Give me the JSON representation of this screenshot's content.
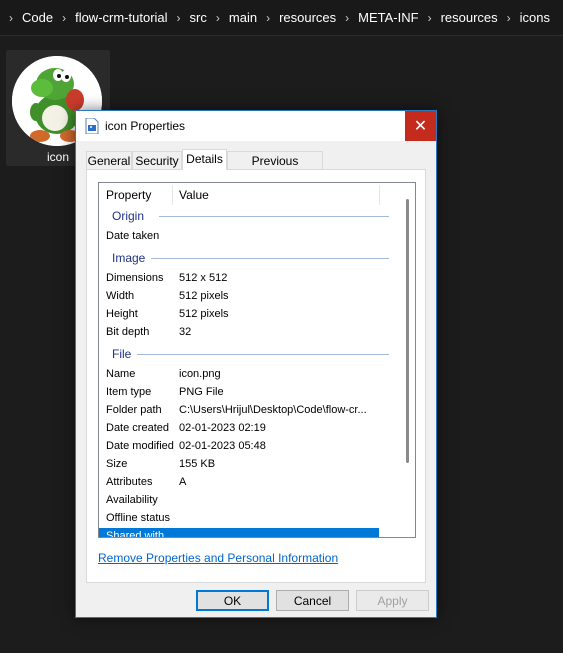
{
  "breadcrumb": [
    {
      "label": "Code"
    },
    {
      "label": "flow-crm-tutorial"
    },
    {
      "label": "src"
    },
    {
      "label": "main"
    },
    {
      "label": "resources"
    },
    {
      "label": "META-INF"
    },
    {
      "label": "resources"
    },
    {
      "label": "icons"
    }
  ],
  "file": {
    "label": "icon"
  },
  "dialog": {
    "title": "icon Properties",
    "close_glyph": "✕",
    "tabs": [
      {
        "label": "General"
      },
      {
        "label": "Security"
      },
      {
        "label": "Details"
      },
      {
        "label": "Previous Versions"
      }
    ],
    "columns": {
      "property": "Property",
      "value": "Value"
    },
    "groups": {
      "origin": "Origin",
      "image": "Image",
      "file": "File"
    },
    "rows": {
      "date_taken": {
        "k": "Date taken",
        "v": ""
      },
      "dimensions": {
        "k": "Dimensions",
        "v": "512 x 512"
      },
      "width": {
        "k": "Width",
        "v": "512 pixels"
      },
      "height": {
        "k": "Height",
        "v": "512 pixels"
      },
      "bit_depth": {
        "k": "Bit depth",
        "v": "32"
      },
      "name": {
        "k": "Name",
        "v": "icon.png"
      },
      "item_type": {
        "k": "Item type",
        "v": "PNG File"
      },
      "folder_path": {
        "k": "Folder path",
        "v": "C:\\Users\\Hrijul\\Desktop\\Code\\flow-cr..."
      },
      "date_created": {
        "k": "Date created",
        "v": "02-01-2023 02:19"
      },
      "date_modified": {
        "k": "Date modified",
        "v": "02-01-2023 05:48"
      },
      "size": {
        "k": "Size",
        "v": "155 KB"
      },
      "attributes": {
        "k": "Attributes",
        "v": "A"
      },
      "availability": {
        "k": "Availability",
        "v": ""
      },
      "offline_status": {
        "k": "Offline status",
        "v": ""
      },
      "shared_with": {
        "k": "Shared with",
        "v": ""
      }
    },
    "remove_link": "Remove Properties and Personal Information",
    "buttons": {
      "ok": "OK",
      "cancel": "Cancel",
      "apply": "Apply"
    }
  },
  "colors": {
    "accent": "#0078d7",
    "close": "#c42b1c",
    "group_text": "#1e3287"
  }
}
